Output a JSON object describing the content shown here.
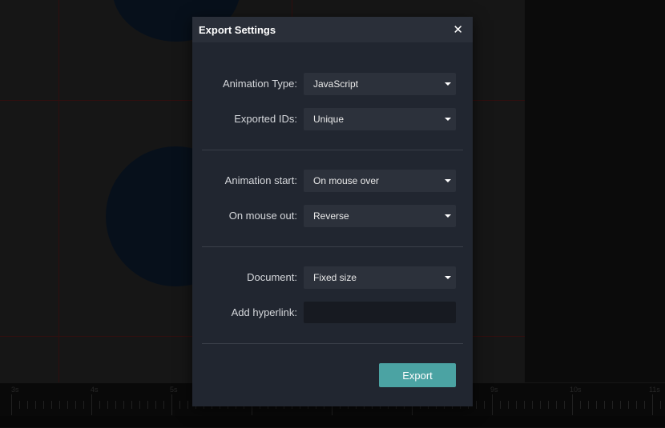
{
  "timeline": {
    "ruler_labels": [
      "3s",
      "4s",
      "5s",
      "9s",
      "10s",
      "11s"
    ]
  },
  "dialog": {
    "title": "Export Settings",
    "close_icon": "close-icon",
    "fields": {
      "animation_type": {
        "label": "Animation Type:",
        "value": "JavaScript"
      },
      "exported_ids": {
        "label": "Exported IDs:",
        "value": "Unique"
      },
      "animation_start": {
        "label": "Animation start:",
        "value": "On mouse over"
      },
      "on_mouse_out": {
        "label": "On mouse out:",
        "value": "Reverse"
      },
      "document": {
        "label": "Document:",
        "value": "Fixed size"
      },
      "add_hyperlink": {
        "label": "Add hyperlink:",
        "value": "",
        "placeholder": ""
      }
    },
    "export_label": "Export"
  },
  "colors": {
    "accent": "#4ba3a3",
    "dialog_bg": "#212630",
    "header_bg": "#2a2f39"
  }
}
